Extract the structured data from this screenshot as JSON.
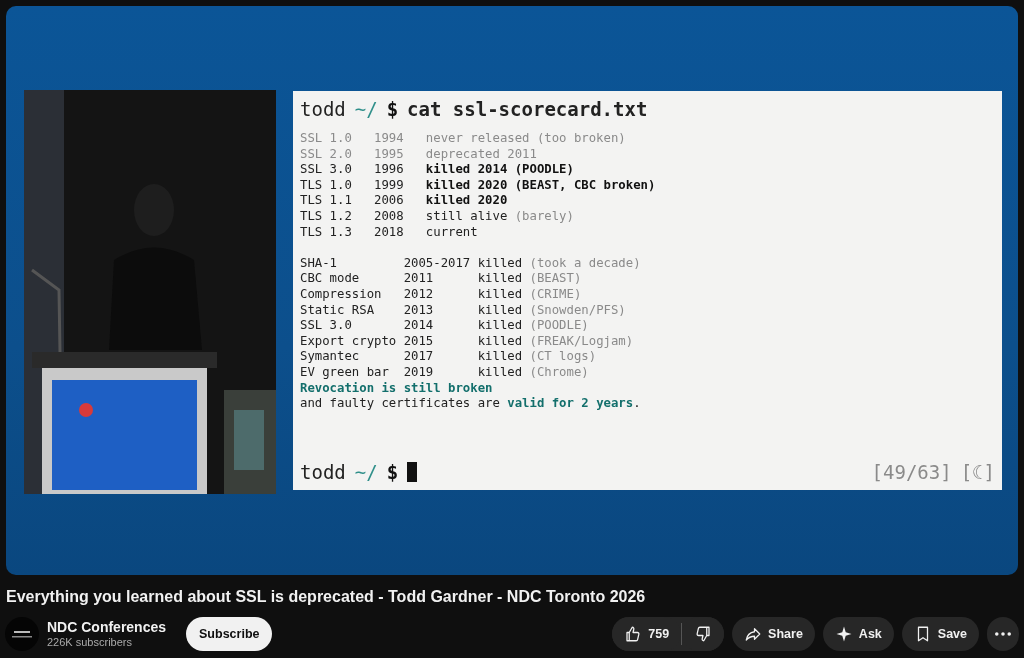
{
  "video": {
    "kind": "picture",
    "slide": {
      "prompt": {
        "user": "todd",
        "path": "~/",
        "symbol": "$",
        "command": "cat ssl-scorecard.txt"
      },
      "versions": [
        {
          "protocol": "SSL 1.0",
          "year": "1994",
          "status": "never released (too broken)",
          "kind": "dim"
        },
        {
          "protocol": "SSL 2.0",
          "year": "1995",
          "status": "deprecated 2011",
          "kind": "dim"
        },
        {
          "protocol": "SSL 3.0",
          "year": "1996",
          "status": "killed 2014 (POODLE)",
          "kind": "bold"
        },
        {
          "protocol": "TLS 1.0",
          "year": "1999",
          "status": "killed 2020 (BEAST, CBC broken)",
          "kind": "bold"
        },
        {
          "protocol": "TLS 1.1",
          "year": "2006",
          "status": "killed 2020",
          "kind": "bold"
        },
        {
          "protocol": "TLS 1.2",
          "year": "2008",
          "status": "still alive",
          "note": "(barely)",
          "kind": "normal"
        },
        {
          "protocol": "TLS 1.3",
          "year": "2018",
          "status": "current",
          "kind": "normal"
        }
      ],
      "features": [
        {
          "name": "SHA-1",
          "years": "2005-2017",
          "status": "killed",
          "note": "(took a decade)"
        },
        {
          "name": "CBC mode",
          "years": "2011",
          "status": "killed",
          "note": "(BEAST)"
        },
        {
          "name": "Compression",
          "years": "2012",
          "status": "killed",
          "note": "(CRIME)"
        },
        {
          "name": "Static RSA",
          "years": "2013",
          "status": "killed",
          "note": "(Snowden/PFS)"
        },
        {
          "name": "SSL 3.0",
          "years": "2014",
          "status": "killed",
          "note": "(POODLE)"
        },
        {
          "name": "Export crypto",
          "years": "2015",
          "status": "killed",
          "note": "(FREAK/Logjam)"
        },
        {
          "name": "Symantec",
          "years": "2017",
          "status": "killed",
          "note": "(CT logs)"
        },
        {
          "name": "EV green bar",
          "years": "2019",
          "status": "killed",
          "note": "(Chrome)"
        }
      ],
      "summary": [
        {
          "text": "Revocation is still broken",
          "kind": "highlight"
        },
        {
          "text": "and faulty certificates are **valid for 2 years**.",
          "kind": "plain"
        }
      ],
      "bottom_prompt": {
        "user": "todd",
        "path": "~/",
        "symbol": "$"
      },
      "counter": "[49/63]",
      "theme_toggle": "[☾]"
    }
  },
  "title": "Everything you learned about SSL is deprecated - Todd Gardner - NDC Toronto 2026",
  "channel": {
    "name": "NDC Conferences",
    "subscribers": "226K subscribers"
  },
  "subscribe_button": "Subscribe",
  "actions": [
    {
      "kind": "like",
      "label": "759"
    },
    {
      "kind": "dislike"
    },
    {
      "kind": "share",
      "label": "Share"
    },
    {
      "kind": "ask",
      "label": "Ask"
    },
    {
      "kind": "save",
      "label": "Save"
    },
    {
      "kind": "more"
    }
  ]
}
